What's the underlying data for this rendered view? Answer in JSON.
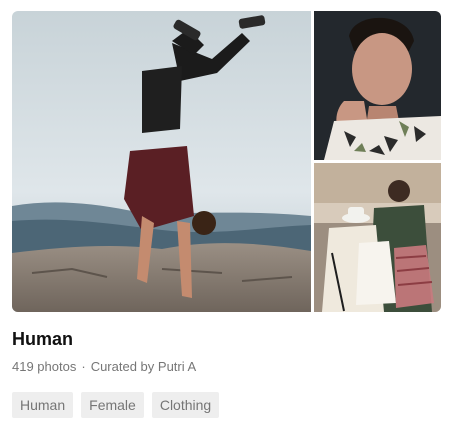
{
  "collection": {
    "title": "Human",
    "photo_count": "419 photos",
    "separator": "·",
    "curated_prefix": "Curated by",
    "curator": "Putri A",
    "tags": [
      "Human",
      "Female",
      "Clothing"
    ]
  }
}
